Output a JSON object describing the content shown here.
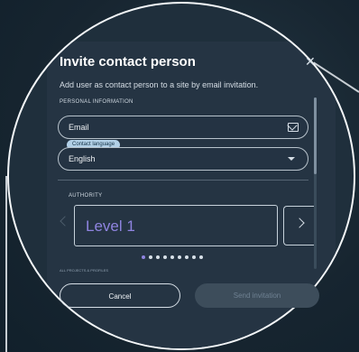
{
  "dialog": {
    "title": "Invite contact person",
    "subtitle": "Add user as contact person to a site by email invitation.",
    "section_personal": "PERSONAL INFORMATION",
    "email_placeholder": "Email",
    "contact_language_label": "Contact language",
    "language_value": "English",
    "section_authority": "AUTHORITY",
    "authority_level": "Level 1",
    "bottom_note": "ALL PROJECTS & PROFILES",
    "cancel_label": "Cancel",
    "send_label": "Send invitation"
  },
  "carousel": {
    "dots": 9,
    "active_index": 0
  },
  "icons": {
    "close": "close-icon",
    "mail": "mail-icon",
    "chevron_down": "chevron-down-icon",
    "chevron_left": "chevron-left-icon",
    "chevron_right": "chevron-right-icon"
  },
  "colors": {
    "accent": "#8f84e0",
    "background": "#1b2b38",
    "dialog": "#253443"
  }
}
